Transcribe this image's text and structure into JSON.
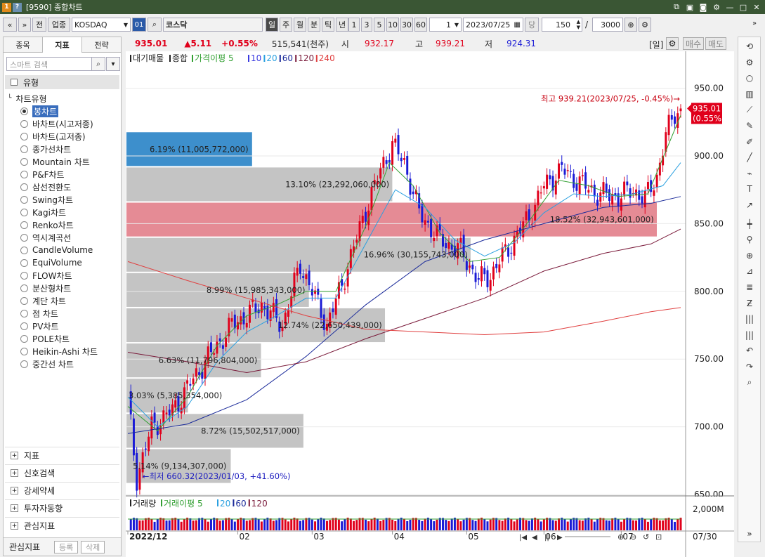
{
  "window": {
    "title": "[9590] 종합차트",
    "logo": "1",
    "help": "?"
  },
  "toolbar": {
    "nav_prev": "«",
    "nav_down": "»",
    "prev": "전",
    "category": "업종",
    "market": "KOSDAQ",
    "code": "01",
    "search_icon": "⌕",
    "name": "코스닥",
    "periods": [
      "일",
      "주",
      "월",
      "분",
      "틱",
      "년"
    ],
    "nums": [
      "1",
      "3",
      "5",
      "10",
      "30",
      "60"
    ],
    "step": "1",
    "date": "2023/07/25",
    "dang": "당",
    "count": "150",
    "slash": "/",
    "total": "3000"
  },
  "left": {
    "tabs": [
      "종목",
      "지표",
      "전략"
    ],
    "search_placeholder": "스마트 검색",
    "section": "유형",
    "tree_root": "차트유형",
    "items": [
      "봉차트",
      "바차트(시고저종)",
      "바차트(고저종)",
      "종가선차트",
      "Mountain 차트",
      "P&F차트",
      "삼선전환도",
      "Swing차트",
      "Kagi차트",
      "Renko차트",
      "역시계곡선",
      "CandleVolume",
      "EquiVolume",
      "FLOW차트",
      "분산형차트",
      "계단 차트",
      "점 차트",
      "PV차트",
      "POLE차트",
      "Heikin-Ashi 차트",
      "중간선 차트"
    ],
    "selected": 0,
    "footer": [
      "지표",
      "신호검색",
      "강세약세",
      "투자자동향",
      "관심지표"
    ],
    "bottom_label": "관심지표",
    "btn_register": "등록",
    "btn_delete": "삭제"
  },
  "quote": {
    "price": "935.01",
    "change": "▲5.11",
    "rate": "+0.55%",
    "volume": "515,541(천주)",
    "open_label": "시",
    "open": "932.17",
    "high_label": "고",
    "high": "939.21",
    "low_label": "저",
    "low": "924.31",
    "period": "[일]",
    "buy": "매수",
    "sell": "매도"
  },
  "colors": {
    "up": "#e0001b",
    "down": "#1a1ad6",
    "ma5": "#33a033",
    "ma10": "#3a3ae0",
    "ma20": "#2aa0e0",
    "ma60": "#1a2a9a",
    "ma120": "#7a1a3a",
    "ma240": "#e04040",
    "pvHi": "#3d8fcc",
    "pvCur": "#e58b95",
    "pvGray": "#c4c4c4"
  },
  "chart_data": {
    "type": "candlestick",
    "legend": [
      "대기매물",
      "종합",
      "가격이평 5",
      "10",
      "20",
      "60",
      "120",
      "240"
    ],
    "ylim": [
      650,
      970
    ],
    "yticks": [
      "950.00",
      "900.00",
      "850.00",
      "800.00",
      "750.00",
      "700.00",
      "650.00"
    ],
    "ytick_values": [
      950,
      900,
      850,
      800,
      750,
      700,
      650
    ],
    "xlabels": [
      "2022/12",
      "02",
      "03",
      "04",
      "05",
      "06",
      "07"
    ],
    "xlabel_days": [
      0,
      37,
      62,
      89,
      114,
      140,
      166
    ],
    "last_price_tag": "935.01",
    "last_rate_tag": "(0.55%)",
    "last_price": 935.01,
    "annot_high": "최고 939.21(2023/07/25, -0.45%)→",
    "annot_low": "←최저 660.32(2023/01/03, +41.60%)",
    "hi_low": [
      [
        3,
        660.32
      ],
      [
        184,
        939.21
      ]
    ],
    "volume_legend": [
      "거래량",
      "거래이평 5",
      "20",
      "60",
      "120"
    ],
    "volume_tick": "2,000M",
    "last_date": "07/30",
    "price_profile": [
      {
        "lo": 658,
        "hi": 684,
        "label": "5.14% (9,134,307,000)",
        "pct": 5.14
      },
      {
        "lo": 684,
        "hi": 710,
        "label": "8.72% (15,502,517,000)",
        "pct": 8.72
      },
      {
        "lo": 710,
        "hi": 736,
        "label": "3.03% (5,385,354,000)",
        "pct": 3.03
      },
      {
        "lo": 736,
        "hi": 762,
        "label": "6.63% (11,796,804,000)",
        "pct": 6.63
      },
      {
        "lo": 762,
        "hi": 788,
        "label": "12.74% (22,650,439,000)",
        "pct": 12.74
      },
      {
        "lo": 788,
        "hi": 814,
        "label": "8.99% (15,985,343,000)",
        "pct": 8.99
      },
      {
        "lo": 814,
        "hi": 840,
        "label": "16.96% (30,155,743,000)",
        "pct": 16.96
      },
      {
        "lo": 840,
        "hi": 866,
        "label": "18.52% (32,943,601,000)",
        "pct": 18.52
      },
      {
        "lo": 866,
        "hi": 892,
        "label": "13.10% (23,292,060,000)",
        "pct": 13.1
      },
      {
        "lo": 892,
        "hi": 918,
        "label": "6.19% (11,005,772,000)",
        "pct": 6.19
      }
    ],
    "current_band": 7,
    "highlight_band": 9,
    "anchors": [
      [
        0,
        720
      ],
      [
        3,
        662
      ],
      [
        8,
        700
      ],
      [
        15,
        712
      ],
      [
        25,
        745
      ],
      [
        35,
        775
      ],
      [
        45,
        790
      ],
      [
        52,
        775
      ],
      [
        58,
        820
      ],
      [
        63,
        795
      ],
      [
        67,
        775
      ],
      [
        72,
        805
      ],
      [
        80,
        860
      ],
      [
        86,
        895
      ],
      [
        89,
        908
      ],
      [
        93,
        895
      ],
      [
        98,
        858
      ],
      [
        105,
        838
      ],
      [
        112,
        830
      ],
      [
        118,
        808
      ],
      [
        122,
        812
      ],
      [
        128,
        832
      ],
      [
        135,
        855
      ],
      [
        140,
        878
      ],
      [
        146,
        890
      ],
      [
        152,
        880
      ],
      [
        158,
        872
      ],
      [
        165,
        870
      ],
      [
        170,
        875
      ],
      [
        174,
        868
      ],
      [
        178,
        885
      ],
      [
        181,
        915
      ],
      [
        184,
        932
      ],
      [
        186,
        935.01
      ]
    ],
    "ma": {
      "5": [
        [
          0,
          715
        ],
        [
          10,
          697
        ],
        [
          20,
          722
        ],
        [
          30,
          760
        ],
        [
          40,
          782
        ],
        [
          50,
          790
        ],
        [
          60,
          800
        ],
        [
          70,
          800
        ],
        [
          80,
          848
        ],
        [
          88,
          895
        ],
        [
          96,
          878
        ],
        [
          105,
          843
        ],
        [
          115,
          822
        ],
        [
          125,
          825
        ],
        [
          135,
          852
        ],
        [
          145,
          882
        ],
        [
          155,
          878
        ],
        [
          165,
          870
        ],
        [
          175,
          872
        ],
        [
          186,
          930
        ]
      ],
      "20": [
        [
          0,
          722
        ],
        [
          10,
          700
        ],
        [
          20,
          715
        ],
        [
          30,
          748
        ],
        [
          40,
          770
        ],
        [
          50,
          782
        ],
        [
          60,
          795
        ],
        [
          70,
          795
        ],
        [
          80,
          835
        ],
        [
          90,
          875
        ],
        [
          100,
          862
        ],
        [
          110,
          838
        ],
        [
          120,
          826
        ],
        [
          130,
          836
        ],
        [
          140,
          858
        ],
        [
          150,
          872
        ],
        [
          160,
          870
        ],
        [
          170,
          872
        ],
        [
          180,
          878
        ],
        [
          186,
          895
        ]
      ],
      "60": [
        [
          0,
          695
        ],
        [
          20,
          702
        ],
        [
          40,
          720
        ],
        [
          60,
          752
        ],
        [
          80,
          790
        ],
        [
          100,
          822
        ],
        [
          120,
          838
        ],
        [
          140,
          850
        ],
        [
          160,
          862
        ],
        [
          176,
          865
        ],
        [
          186,
          870
        ]
      ],
      "120": [
        [
          0,
          755
        ],
        [
          20,
          748
        ],
        [
          40,
          740
        ],
        [
          60,
          748
        ],
        [
          80,
          765
        ],
        [
          100,
          780
        ],
        [
          120,
          795
        ],
        [
          140,
          815
        ],
        [
          160,
          828
        ],
        [
          176,
          835
        ],
        [
          186,
          846
        ]
      ],
      "240": [
        [
          0,
          822
        ],
        [
          20,
          808
        ],
        [
          40,
          795
        ],
        [
          60,
          782
        ],
        [
          80,
          772
        ],
        [
          100,
          770
        ],
        [
          120,
          768
        ],
        [
          140,
          770
        ],
        [
          160,
          778
        ],
        [
          176,
          785
        ],
        [
          186,
          788
        ]
      ]
    }
  }
}
